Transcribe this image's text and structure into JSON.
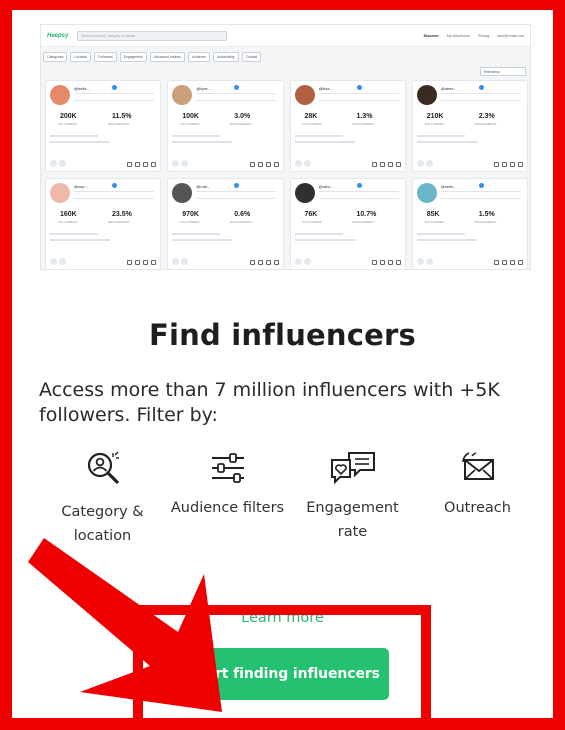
{
  "preview": {
    "logo": "Heepsy",
    "search_placeholder": "Search keyword, category or handle",
    "nav": [
      "Discover",
      "My influencers",
      "Pricing",
      "user@email.com"
    ],
    "filters": [
      "Categories",
      "Location",
      "Followers",
      "Engagement",
      "Advanced metrics",
      "Audience",
      "Authenticity",
      "Contact"
    ],
    "sort_label": "Relevancy",
    "cards": [
      {
        "handle": "@bella...",
        "followers": "200K",
        "engagement": "11.5%",
        "avatar_color": "#e48a6a"
      },
      {
        "handle": "@lyne...",
        "followers": "100K",
        "engagement": "3.0%",
        "avatar_color": "#c9a07a"
      },
      {
        "handle": "@kiss...",
        "followers": "28K",
        "engagement": "1.3%",
        "avatar_color": "#b06040"
      },
      {
        "handle": "@dees...",
        "followers": "210K",
        "engagement": "2.3%",
        "avatar_color": "#3a2a22"
      },
      {
        "handle": "@sop...",
        "followers": "160K",
        "engagement": "23.5%",
        "avatar_color": "#f0b8a8"
      },
      {
        "handle": "@robi...",
        "followers": "970K",
        "engagement": "0.6%",
        "avatar_color": "#555555"
      },
      {
        "handle": "@alex...",
        "followers": "76K",
        "engagement": "10.7%",
        "avatar_color": "#303030"
      },
      {
        "handle": "@seek...",
        "followers": "85K",
        "engagement": "1.5%",
        "avatar_color": "#6ab6c8"
      }
    ],
    "followers_label": "FOLLOWERS",
    "engagement_label": "ENGAGEMENT"
  },
  "heading": "Find influencers",
  "lead": "Access more than 7 million influencers with +5K followers. Filter by:",
  "features": [
    {
      "label": "Category & location",
      "icon": "search-person-icon"
    },
    {
      "label": "Audience filters",
      "icon": "sliders-icon"
    },
    {
      "label": "Engagement rate",
      "icon": "chat-heart-icon"
    },
    {
      "label": "Outreach",
      "icon": "envelope-icon"
    }
  ],
  "learn_more": "Learn more",
  "cta": "Start finding influencers",
  "colors": {
    "accent": "#24c270",
    "annotation": "#ee0000"
  }
}
